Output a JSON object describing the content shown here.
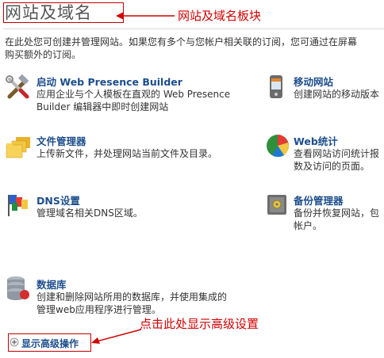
{
  "section": {
    "title": "网站及域名",
    "annotation": "网站及域名板块"
  },
  "intro": {
    "line1": "在此处您可创建并管理网站。如果您有多个与您帐户相关联的订阅，您可通过在屏幕",
    "line2": "购买额外的订阅。"
  },
  "tools": {
    "presence": {
      "title": "启动 Web Presence Builder",
      "desc1": "应用企业与个人模板在直观的 Web Presence",
      "desc2": "Builder 编辑器中即时创建网站",
      "icon": "tools-icon"
    },
    "mobile": {
      "title": "移动网站",
      "desc1": "创建网站的移动版本",
      "icon": "mobile-phone-icon"
    },
    "files": {
      "title": "文件管理器",
      "desc1": "上传新文件，并处理网站当前文件及目录。",
      "icon": "folders-icon"
    },
    "webstat": {
      "title": "Web统计",
      "desc1": "查看网站访问统计报",
      "desc2": "数及访问的页面。",
      "icon": "pie-chart-icon"
    },
    "dns": {
      "title": "DNS设置",
      "desc1": "管理域名相关DNS区域。",
      "icon": "flags-icon"
    },
    "backup": {
      "title": "备份管理器",
      "desc1": "备份并恢复网站，包",
      "desc2": "帐户。",
      "icon": "safe-icon"
    },
    "database": {
      "title": "数据库",
      "desc1": "创建和删除网站所用的数据库，并使用集成的",
      "desc2": "管理web应用程序进行管理。",
      "icon": "database-icon"
    }
  },
  "advanced": {
    "label": "显示高级操作",
    "annotation": "点击此处显示高级设置",
    "icon": "expand-icon"
  },
  "colors": {
    "link": "#1d4e8c",
    "annotation": "#d00000"
  }
}
